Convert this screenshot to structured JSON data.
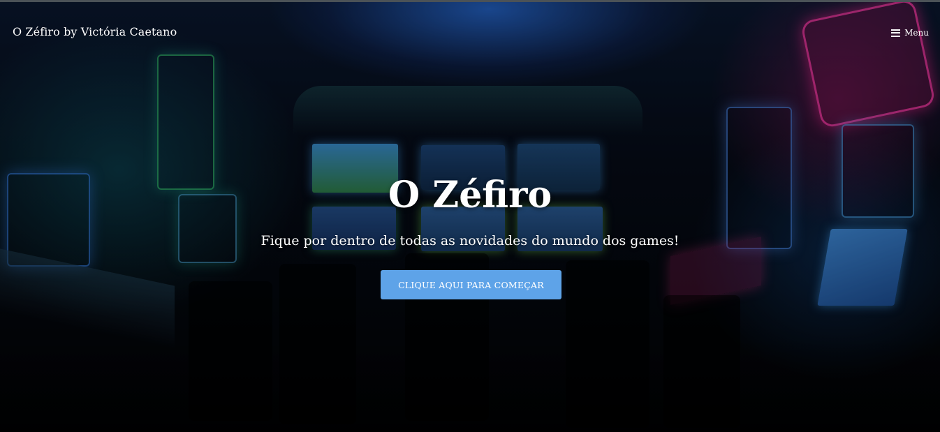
{
  "nav": {
    "brand": "O Zéfiro by Victória Caetano",
    "menu_label": "Menu",
    "menu_icon": "hamburger-icon"
  },
  "hero": {
    "title": "O Zéfiro",
    "subtitle": "Fique por dentro de todas as novidades do mundo dos games!",
    "cta_label": "CLIQUE AQUI PARA COMEÇAR",
    "background": "arcade room photo with neon slot machines",
    "colors": {
      "cta_background": "#5ea3e8",
      "text": "#ffffff"
    }
  }
}
